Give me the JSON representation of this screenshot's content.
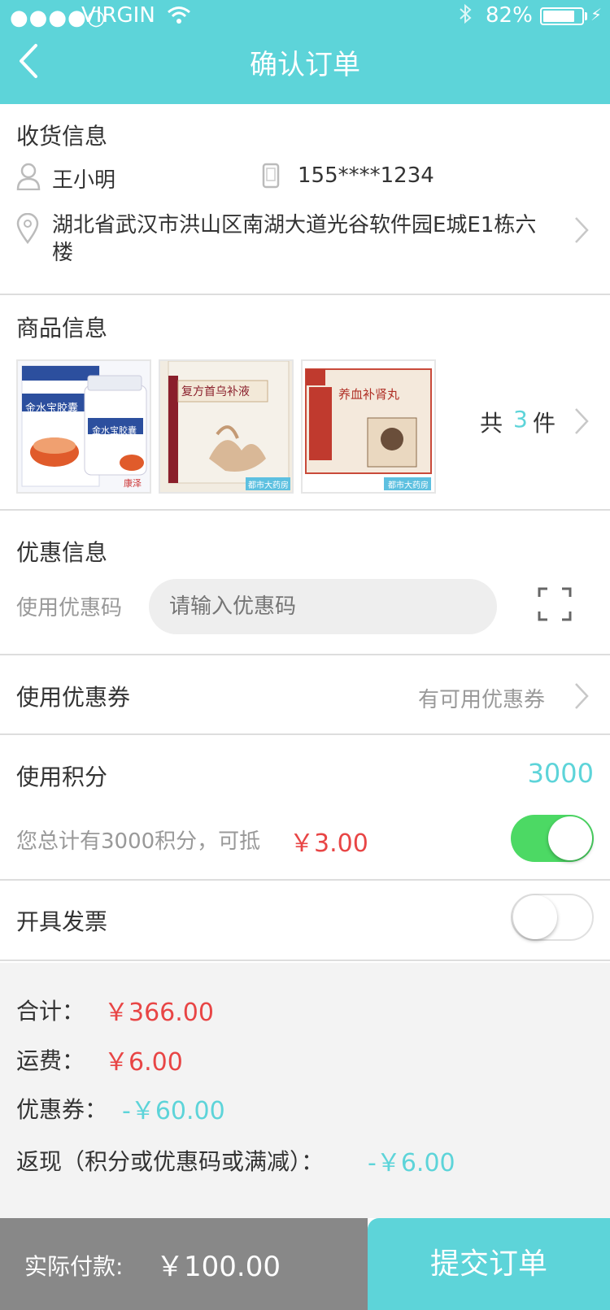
{
  "status_bar": {
    "signal": "●●●●○",
    "carrier": "VIRGIN",
    "battery": "82%"
  },
  "nav": {
    "title": "确认订单"
  },
  "shipping": {
    "title": "收货信息",
    "name": "王小明",
    "phone": "155****1234",
    "address": "湖北省武汉市洪山区南湖大道光谷软件园E城E1栋六楼"
  },
  "products": {
    "title": "商品信息",
    "items": [
      {
        "name": "金水宝胶囊",
        "badge": "康泽"
      },
      {
        "name": "复方首乌补液",
        "badge": "都市大药房"
      },
      {
        "name": "养血补肾丸",
        "badge": "都市大药房"
      }
    ],
    "count_prefix": "共",
    "count": "3",
    "count_suffix": "件"
  },
  "discount": {
    "title": "优惠信息",
    "code_label": "使用优惠码",
    "code_placeholder": "请输入优惠码"
  },
  "coupon": {
    "label": "使用优惠券",
    "value": "有可用优惠券"
  },
  "points": {
    "label": "使用积分",
    "value": "3000",
    "desc": "您总计有3000积分，可抵",
    "deduct": "￥3.00",
    "enabled": true
  },
  "invoice": {
    "label": "开具发票",
    "enabled": false
  },
  "summary": {
    "total_label": "合计：",
    "total_value": "￥366.00",
    "shipping_label": "运费：",
    "shipping_value": "￥6.00",
    "coupon_label": "优惠券：",
    "coupon_value": "-￥60.00",
    "cashback_label": "返现（积分或优惠码或满减）：",
    "cashback_value": "-￥6.00"
  },
  "footer": {
    "pay_label": "实际付款:",
    "pay_value": "￥100.00",
    "submit_label": "提交订单"
  },
  "colors": {
    "accent": "#5dd4d9",
    "price": "#e84545",
    "toggle_on": "#4cd964",
    "footer_gray": "#888888"
  }
}
